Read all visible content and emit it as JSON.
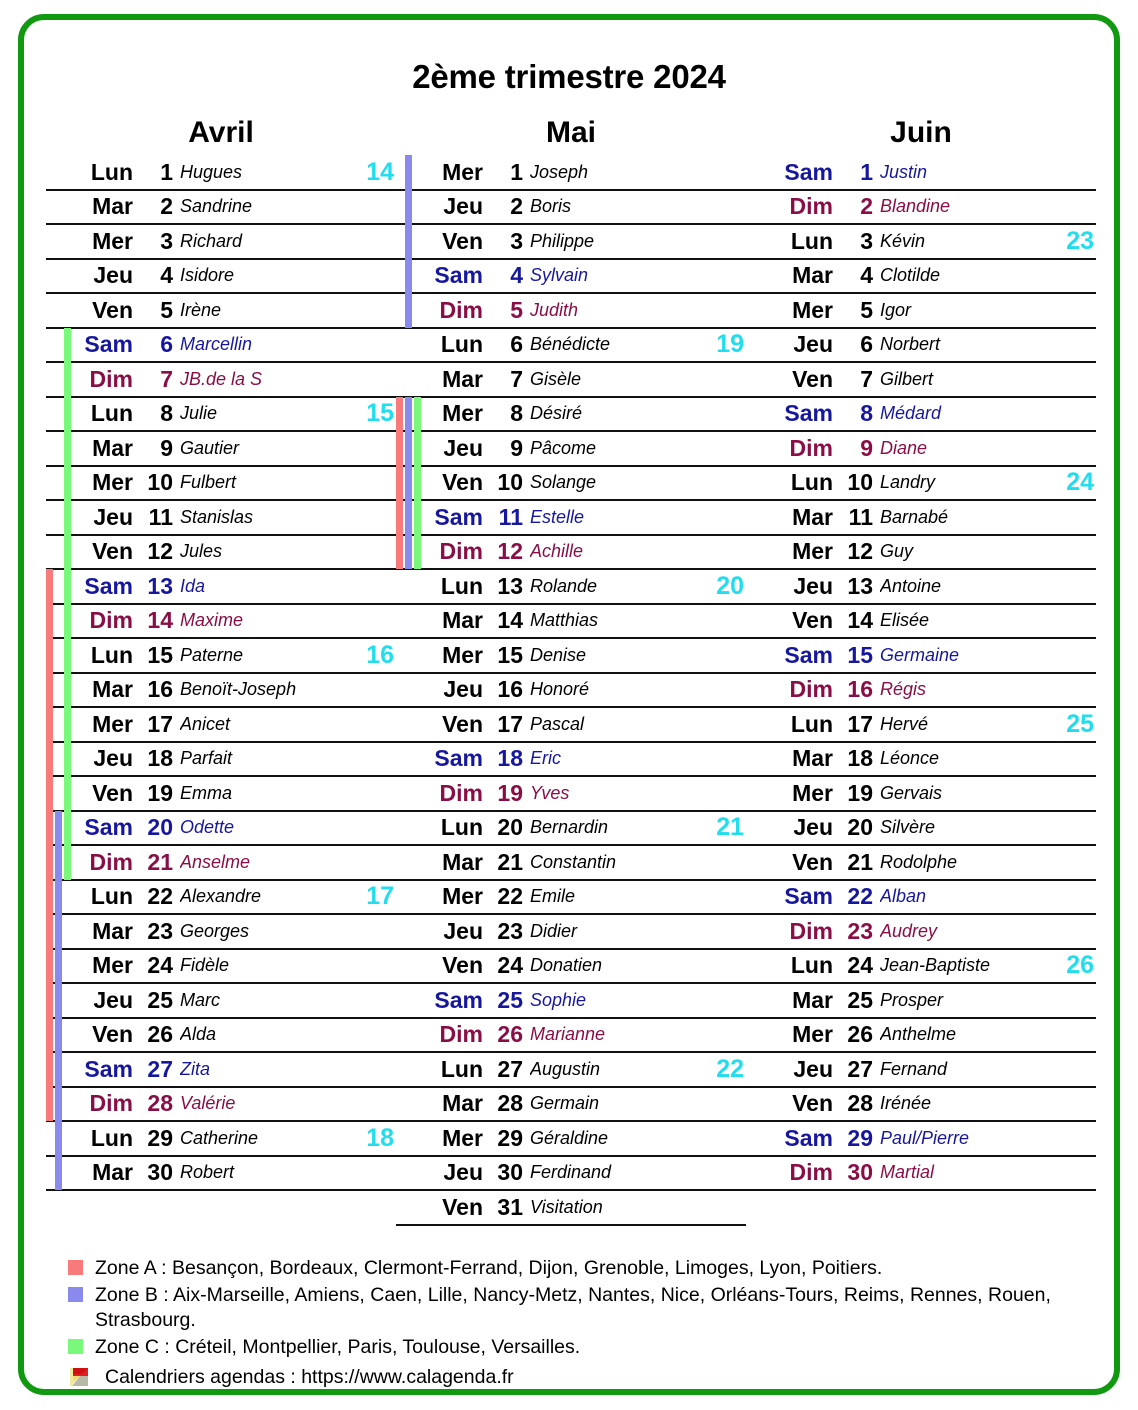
{
  "title": "2ème trimestre 2024",
  "colors": {
    "border": "#119911",
    "week_number": "#22DDEE",
    "saturday": "#17179E",
    "sunday": "#8A0E46",
    "zone_a": "#F87A7A",
    "zone_b": "#8A8AEE",
    "zone_c": "#79F879"
  },
  "months": [
    {
      "name": "Avril",
      "days": [
        {
          "dow": "Lun",
          "num": "1",
          "saint": "Hugues",
          "type": "weekday",
          "week": "14",
          "zones": []
        },
        {
          "dow": "Mar",
          "num": "2",
          "saint": "Sandrine",
          "type": "weekday",
          "week": "",
          "zones": []
        },
        {
          "dow": "Mer",
          "num": "3",
          "saint": "Richard",
          "type": "weekday",
          "week": "",
          "zones": []
        },
        {
          "dow": "Jeu",
          "num": "4",
          "saint": "Isidore",
          "type": "weekday",
          "week": "",
          "zones": []
        },
        {
          "dow": "Ven",
          "num": "5",
          "saint": "Irène",
          "type": "weekday",
          "week": "",
          "zones": []
        },
        {
          "dow": "Sam",
          "num": "6",
          "saint": "Marcellin",
          "type": "sat",
          "week": "",
          "zones": [
            "c"
          ]
        },
        {
          "dow": "Dim",
          "num": "7",
          "saint": "JB.de la S",
          "type": "sun",
          "week": "",
          "zones": [
            "c"
          ]
        },
        {
          "dow": "Lun",
          "num": "8",
          "saint": "Julie",
          "type": "weekday",
          "week": "15",
          "zones": [
            "c"
          ]
        },
        {
          "dow": "Mar",
          "num": "9",
          "saint": "Gautier",
          "type": "weekday",
          "week": "",
          "zones": [
            "c"
          ]
        },
        {
          "dow": "Mer",
          "num": "10",
          "saint": "Fulbert",
          "type": "weekday",
          "week": "",
          "zones": [
            "c"
          ]
        },
        {
          "dow": "Jeu",
          "num": "11",
          "saint": "Stanislas",
          "type": "weekday",
          "week": "",
          "zones": [
            "c"
          ]
        },
        {
          "dow": "Ven",
          "num": "12",
          "saint": "Jules",
          "type": "weekday",
          "week": "",
          "zones": [
            "c"
          ]
        },
        {
          "dow": "Sam",
          "num": "13",
          "saint": "Ida",
          "type": "sat",
          "week": "",
          "zones": [
            "a",
            "c"
          ]
        },
        {
          "dow": "Dim",
          "num": "14",
          "saint": "Maxime",
          "type": "sun",
          "week": "",
          "zones": [
            "a",
            "c"
          ]
        },
        {
          "dow": "Lun",
          "num": "15",
          "saint": "Paterne",
          "type": "weekday",
          "week": "16",
          "zones": [
            "a",
            "c"
          ]
        },
        {
          "dow": "Mar",
          "num": "16",
          "saint": "Benoït-Joseph",
          "type": "weekday",
          "week": "",
          "zones": [
            "a",
            "c"
          ]
        },
        {
          "dow": "Mer",
          "num": "17",
          "saint": "Anicet",
          "type": "weekday",
          "week": "",
          "zones": [
            "a",
            "c"
          ]
        },
        {
          "dow": "Jeu",
          "num": "18",
          "saint": "Parfait",
          "type": "weekday",
          "week": "",
          "zones": [
            "a",
            "c"
          ]
        },
        {
          "dow": "Ven",
          "num": "19",
          "saint": "Emma",
          "type": "weekday",
          "week": "",
          "zones": [
            "a",
            "c"
          ]
        },
        {
          "dow": "Sam",
          "num": "20",
          "saint": "Odette",
          "type": "sat",
          "week": "",
          "zones": [
            "a",
            "b",
            "c"
          ]
        },
        {
          "dow": "Dim",
          "num": "21",
          "saint": "Anselme",
          "type": "sun",
          "week": "",
          "zones": [
            "a",
            "b",
            "c"
          ]
        },
        {
          "dow": "Lun",
          "num": "22",
          "saint": "Alexandre",
          "type": "weekday",
          "week": "17",
          "zones": [
            "a",
            "b"
          ]
        },
        {
          "dow": "Mar",
          "num": "23",
          "saint": "Georges",
          "type": "weekday",
          "week": "",
          "zones": [
            "a",
            "b"
          ]
        },
        {
          "dow": "Mer",
          "num": "24",
          "saint": "Fidèle",
          "type": "weekday",
          "week": "",
          "zones": [
            "a",
            "b"
          ]
        },
        {
          "dow": "Jeu",
          "num": "25",
          "saint": "Marc",
          "type": "weekday",
          "week": "",
          "zones": [
            "a",
            "b"
          ]
        },
        {
          "dow": "Ven",
          "num": "26",
          "saint": "Alda",
          "type": "weekday",
          "week": "",
          "zones": [
            "a",
            "b"
          ]
        },
        {
          "dow": "Sam",
          "num": "27",
          "saint": "Zita",
          "type": "sat",
          "week": "",
          "zones": [
            "a",
            "b"
          ]
        },
        {
          "dow": "Dim",
          "num": "28",
          "saint": "Valérie",
          "type": "sun",
          "week": "",
          "zones": [
            "a",
            "b"
          ]
        },
        {
          "dow": "Lun",
          "num": "29",
          "saint": "Catherine",
          "type": "weekday",
          "week": "18",
          "zones": [
            "b"
          ]
        },
        {
          "dow": "Mar",
          "num": "30",
          "saint": "Robert",
          "type": "weekday",
          "week": "",
          "zones": [
            "b"
          ]
        }
      ]
    },
    {
      "name": "Mai",
      "days": [
        {
          "dow": "Mer",
          "num": "1",
          "saint": "Joseph",
          "type": "weekday",
          "week": "",
          "zones": [
            "b"
          ]
        },
        {
          "dow": "Jeu",
          "num": "2",
          "saint": "Boris",
          "type": "weekday",
          "week": "",
          "zones": [
            "b"
          ]
        },
        {
          "dow": "Ven",
          "num": "3",
          "saint": "Philippe",
          "type": "weekday",
          "week": "",
          "zones": [
            "b"
          ]
        },
        {
          "dow": "Sam",
          "num": "4",
          "saint": "Sylvain",
          "type": "sat",
          "week": "",
          "zones": [
            "b"
          ]
        },
        {
          "dow": "Dim",
          "num": "5",
          "saint": "Judith",
          "type": "sun",
          "week": "",
          "zones": [
            "b"
          ]
        },
        {
          "dow": "Lun",
          "num": "6",
          "saint": "Bénédicte",
          "type": "weekday",
          "week": "19",
          "zones": []
        },
        {
          "dow": "Mar",
          "num": "7",
          "saint": "Gisèle",
          "type": "weekday",
          "week": "",
          "zones": []
        },
        {
          "dow": "Mer",
          "num": "8",
          "saint": "Désiré",
          "type": "weekday",
          "week": "",
          "zones": [
            "a",
            "b",
            "c"
          ]
        },
        {
          "dow": "Jeu",
          "num": "9",
          "saint": "Pâcome",
          "type": "weekday",
          "week": "",
          "zones": [
            "a",
            "b",
            "c"
          ]
        },
        {
          "dow": "Ven",
          "num": "10",
          "saint": "Solange",
          "type": "weekday",
          "week": "",
          "zones": [
            "a",
            "b",
            "c"
          ]
        },
        {
          "dow": "Sam",
          "num": "11",
          "saint": "Estelle",
          "type": "sat",
          "week": "",
          "zones": [
            "a",
            "b",
            "c"
          ]
        },
        {
          "dow": "Dim",
          "num": "12",
          "saint": "Achille",
          "type": "sun",
          "week": "",
          "zones": [
            "a",
            "b",
            "c"
          ]
        },
        {
          "dow": "Lun",
          "num": "13",
          "saint": "Rolande",
          "type": "weekday",
          "week": "20",
          "zones": []
        },
        {
          "dow": "Mar",
          "num": "14",
          "saint": "Matthias",
          "type": "weekday",
          "week": "",
          "zones": []
        },
        {
          "dow": "Mer",
          "num": "15",
          "saint": "Denise",
          "type": "weekday",
          "week": "",
          "zones": []
        },
        {
          "dow": "Jeu",
          "num": "16",
          "saint": "Honoré",
          "type": "weekday",
          "week": "",
          "zones": []
        },
        {
          "dow": "Ven",
          "num": "17",
          "saint": "Pascal",
          "type": "weekday",
          "week": "",
          "zones": []
        },
        {
          "dow": "Sam",
          "num": "18",
          "saint": "Eric",
          "type": "sat",
          "week": "",
          "zones": []
        },
        {
          "dow": "Dim",
          "num": "19",
          "saint": "Yves",
          "type": "sun",
          "week": "",
          "zones": []
        },
        {
          "dow": "Lun",
          "num": "20",
          "saint": "Bernardin",
          "type": "weekday",
          "week": "21",
          "zones": []
        },
        {
          "dow": "Mar",
          "num": "21",
          "saint": "Constantin",
          "type": "weekday",
          "week": "",
          "zones": []
        },
        {
          "dow": "Mer",
          "num": "22",
          "saint": "Emile",
          "type": "weekday",
          "week": "",
          "zones": []
        },
        {
          "dow": "Jeu",
          "num": "23",
          "saint": "Didier",
          "type": "weekday",
          "week": "",
          "zones": []
        },
        {
          "dow": "Ven",
          "num": "24",
          "saint": "Donatien",
          "type": "weekday",
          "week": "",
          "zones": []
        },
        {
          "dow": "Sam",
          "num": "25",
          "saint": "Sophie",
          "type": "sat",
          "week": "",
          "zones": []
        },
        {
          "dow": "Dim",
          "num": "26",
          "saint": "Marianne",
          "type": "sun",
          "week": "",
          "zones": []
        },
        {
          "dow": "Lun",
          "num": "27",
          "saint": "Augustin",
          "type": "weekday",
          "week": "22",
          "zones": []
        },
        {
          "dow": "Mar",
          "num": "28",
          "saint": "Germain",
          "type": "weekday",
          "week": "",
          "zones": []
        },
        {
          "dow": "Mer",
          "num": "29",
          "saint": "Géraldine",
          "type": "weekday",
          "week": "",
          "zones": []
        },
        {
          "dow": "Jeu",
          "num": "30",
          "saint": "Ferdinand",
          "type": "weekday",
          "week": "",
          "zones": []
        },
        {
          "dow": "Ven",
          "num": "31",
          "saint": "Visitation",
          "type": "weekday",
          "week": "",
          "zones": []
        }
      ]
    },
    {
      "name": "Juin",
      "days": [
        {
          "dow": "Sam",
          "num": "1",
          "saint": "Justin",
          "type": "sat",
          "week": "",
          "zones": []
        },
        {
          "dow": "Dim",
          "num": "2",
          "saint": "Blandine",
          "type": "sun",
          "week": "",
          "zones": []
        },
        {
          "dow": "Lun",
          "num": "3",
          "saint": "Kévin",
          "type": "weekday",
          "week": "23",
          "zones": []
        },
        {
          "dow": "Mar",
          "num": "4",
          "saint": "Clotilde",
          "type": "weekday",
          "week": "",
          "zones": []
        },
        {
          "dow": "Mer",
          "num": "5",
          "saint": "Igor",
          "type": "weekday",
          "week": "",
          "zones": []
        },
        {
          "dow": "Jeu",
          "num": "6",
          "saint": "Norbert",
          "type": "weekday",
          "week": "",
          "zones": []
        },
        {
          "dow": "Ven",
          "num": "7",
          "saint": "Gilbert",
          "type": "weekday",
          "week": "",
          "zones": []
        },
        {
          "dow": "Sam",
          "num": "8",
          "saint": "Médard",
          "type": "sat",
          "week": "",
          "zones": []
        },
        {
          "dow": "Dim",
          "num": "9",
          "saint": "Diane",
          "type": "sun",
          "week": "",
          "zones": []
        },
        {
          "dow": "Lun",
          "num": "10",
          "saint": "Landry",
          "type": "weekday",
          "week": "24",
          "zones": []
        },
        {
          "dow": "Mar",
          "num": "11",
          "saint": "Barnabé",
          "type": "weekday",
          "week": "",
          "zones": []
        },
        {
          "dow": "Mer",
          "num": "12",
          "saint": "Guy",
          "type": "weekday",
          "week": "",
          "zones": []
        },
        {
          "dow": "Jeu",
          "num": "13",
          "saint": "Antoine",
          "type": "weekday",
          "week": "",
          "zones": []
        },
        {
          "dow": "Ven",
          "num": "14",
          "saint": "Elisée",
          "type": "weekday",
          "week": "",
          "zones": []
        },
        {
          "dow": "Sam",
          "num": "15",
          "saint": "Germaine",
          "type": "sat",
          "week": "",
          "zones": []
        },
        {
          "dow": "Dim",
          "num": "16",
          "saint": "Régis",
          "type": "sun",
          "week": "",
          "zones": []
        },
        {
          "dow": "Lun",
          "num": "17",
          "saint": "Hervé",
          "type": "weekday",
          "week": "25",
          "zones": []
        },
        {
          "dow": "Mar",
          "num": "18",
          "saint": "Léonce",
          "type": "weekday",
          "week": "",
          "zones": []
        },
        {
          "dow": "Mer",
          "num": "19",
          "saint": "Gervais",
          "type": "weekday",
          "week": "",
          "zones": []
        },
        {
          "dow": "Jeu",
          "num": "20",
          "saint": "Silvère",
          "type": "weekday",
          "week": "",
          "zones": []
        },
        {
          "dow": "Ven",
          "num": "21",
          "saint": "Rodolphe",
          "type": "weekday",
          "week": "",
          "zones": []
        },
        {
          "dow": "Sam",
          "num": "22",
          "saint": "Alban",
          "type": "sat",
          "week": "",
          "zones": []
        },
        {
          "dow": "Dim",
          "num": "23",
          "saint": "Audrey",
          "type": "sun",
          "week": "",
          "zones": []
        },
        {
          "dow": "Lun",
          "num": "24",
          "saint": "Jean-Baptiste",
          "type": "weekday",
          "week": "26",
          "zones": []
        },
        {
          "dow": "Mar",
          "num": "25",
          "saint": "Prosper",
          "type": "weekday",
          "week": "",
          "zones": []
        },
        {
          "dow": "Mer",
          "num": "26",
          "saint": "Anthelme",
          "type": "weekday",
          "week": "",
          "zones": []
        },
        {
          "dow": "Jeu",
          "num": "27",
          "saint": "Fernand",
          "type": "weekday",
          "week": "",
          "zones": []
        },
        {
          "dow": "Ven",
          "num": "28",
          "saint": "Irénée",
          "type": "weekday",
          "week": "",
          "zones": []
        },
        {
          "dow": "Sam",
          "num": "29",
          "saint": "Paul/Pierre",
          "type": "sat",
          "week": "",
          "zones": []
        },
        {
          "dow": "Dim",
          "num": "30",
          "saint": "Martial",
          "type": "sun",
          "week": "",
          "zones": []
        }
      ]
    }
  ],
  "legend": {
    "zone_a": "Zone A : Besançon, Bordeaux, Clermont-Ferrand, Dijon, Grenoble, Limoges, Lyon, Poitiers.",
    "zone_b": "Zone B : Aix-Marseille, Amiens, Caen, Lille, Nancy-Metz, Nantes, Nice, Orléans-Tours, Reims, Rennes, Rouen, Strasbourg.",
    "zone_c": "Zone C : Créteil, Montpellier, Paris, Toulouse, Versailles.",
    "credit": "Calendriers agendas : https://www.calagenda.fr"
  }
}
